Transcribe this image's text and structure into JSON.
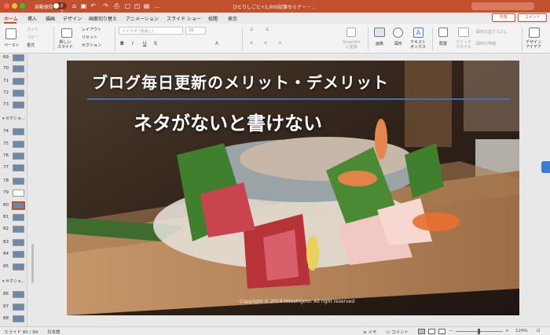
{
  "titlebar": {
    "autosave_label": "自動保存",
    "autosave_state": "オフ",
    "document_title": "ひとりしごと+1,000記事セミナー・...",
    "background_color": "#c1502e"
  },
  "tabs": [
    "ホーム",
    "挿入",
    "描画",
    "デザイン",
    "画面切り替え",
    "アニメーション",
    "スライド ショー",
    "校閲",
    "表示"
  ],
  "active_tab": "ホーム",
  "header_buttons": {
    "share": "共有",
    "comment": "コメント"
  },
  "ribbon": {
    "paste": "ペースト",
    "cut": "カット",
    "copy": "コピー",
    "format": "書式",
    "new_slide": "新しい\nスライド",
    "layout": "レイアウト",
    "reset": "リセット",
    "section": "セクション",
    "font_placeholder": "メイリオ (見出し)",
    "font_size": "38",
    "smartart": "SmartArt\nに変換",
    "picture": "画像",
    "shapes": "図形",
    "textbox": "テキスト\nボックス",
    "arrange": "配置",
    "quick_styles": "クイック\nスタイル",
    "shape_fill": "図形の塗りつぶし",
    "shape_outline": "図形の枠線",
    "design_ideas": "デザイン\nアイデア"
  },
  "sidebar": {
    "rows": [
      {
        "num": "69",
        "thumb": "photo"
      },
      {
        "num": "70",
        "thumb": "photo"
      },
      {
        "num": "71",
        "thumb": "photo"
      },
      {
        "num": "72",
        "thumb": "photo"
      },
      {
        "num": "73",
        "thumb": "photo"
      },
      {
        "num": "74",
        "thumb": "photo"
      },
      {
        "num": "75",
        "thumb": "photo"
      },
      {
        "num": "76",
        "thumb": "photo"
      },
      {
        "num": "77",
        "thumb": "photo"
      },
      {
        "num": "78",
        "thumb": "photo"
      },
      {
        "num": "79",
        "thumb": "white"
      },
      {
        "num": "80",
        "thumb": "photo",
        "selected": true
      },
      {
        "num": "81",
        "thumb": "photo"
      },
      {
        "num": "82",
        "thumb": "photo"
      },
      {
        "num": "83",
        "thumb": "photo"
      },
      {
        "num": "84",
        "thumb": "photo"
      },
      {
        "num": "85",
        "thumb": "photo"
      },
      {
        "num": "86",
        "thumb": "photo"
      },
      {
        "num": "87",
        "thumb": "photo"
      },
      {
        "num": "88",
        "thumb": "photo"
      }
    ],
    "section_label_1": "セクショ...",
    "section_label_2": "セクショ..."
  },
  "slide": {
    "title": "ブログ毎日更新のメリット・デメリット",
    "subtitle": "ネタがないと書けない",
    "copyright": "Copyright © 2019 Hitoshigoto. All right reserved",
    "rule_color": "#3f6fb6"
  },
  "statusbar": {
    "slide_info": "スライド 80 / 99",
    "language": "日本語",
    "notes": "メモ",
    "comments": "コメント",
    "zoom": "124%"
  }
}
